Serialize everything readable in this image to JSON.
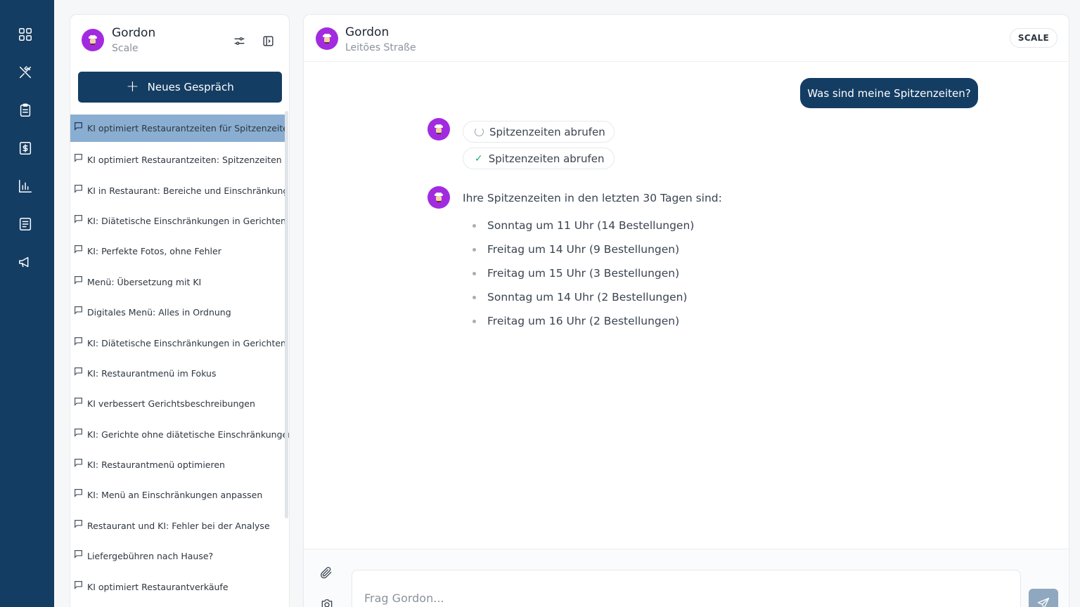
{
  "assistant": {
    "name": "Gordon",
    "subtitle": "Scale"
  },
  "sidebar": {
    "new_chat_label": "Neues Gespräch",
    "conversations": [
      "KI optimiert Restaurantzeiten für Spitzenzeiten",
      "KI optimiert Restaurantzeiten: Spitzenzeiten",
      "KI in Restaurant: Bereiche und Einschränkungen",
      "KI: Diätetische Einschränkungen in Gerichten",
      "KI: Perfekte Fotos, ohne Fehler",
      "Menü: Übersetzung mit KI",
      "Digitales Menü: Alles in Ordnung",
      "KI: Diätetische Einschränkungen in Gerichten",
      "KI: Restaurantmenü im Fokus",
      "KI verbessert Gerichtsbeschreibungen",
      "KI: Gerichte ohne diätetische Einschränkungen",
      "KI: Restaurantmenü optimieren",
      "KI: Menü an Einschränkungen anpassen",
      "Restaurant und KI: Fehler bei der Analyse",
      "Liefergebühren nach Hause?",
      "KI optimiert Restaurantverkäufe"
    ]
  },
  "header": {
    "title": "Gordon",
    "location": "Leitões Straße",
    "badge": "SCALE"
  },
  "messages": {
    "user": "Was sind meine Spitzenzeiten?",
    "tools": [
      {
        "label": "Spitzenzeiten abrufen",
        "state": "loading"
      },
      {
        "label": "Spitzenzeiten abrufen",
        "state": "done"
      }
    ],
    "answer_intro": "Ihre Spitzenzeiten in den letzten 30 Tagen sind:",
    "answer_items": [
      "Sonntag um 11 Uhr (14 Bestellungen)",
      "Freitag um 14 Uhr (9 Bestellungen)",
      "Freitag um 15 Uhr (3 Bestellungen)",
      "Sonntag um 14 Uhr (2 Bestellungen)",
      "Freitag um 16 Uhr (2 Bestellungen)"
    ]
  },
  "composer": {
    "placeholder": "Frag Gordon..."
  },
  "colors": {
    "navy": "#143d63",
    "avatar_purple": "#a22be0",
    "active_item": "#8aaed1",
    "check_green": "#1fae77"
  },
  "icons": {
    "rail": [
      "dashboard-grid-icon",
      "utensils-icon",
      "clipboard-icon",
      "dollar-icon",
      "bar-chart-icon",
      "document-list-icon",
      "megaphone-icon"
    ],
    "header": [
      "settings-sliders-icon",
      "sidebar-panel-icon"
    ],
    "conversation": "chat-bubble-icon",
    "composer": [
      "paperclip-icon",
      "camera-icon",
      "send-icon"
    ]
  }
}
